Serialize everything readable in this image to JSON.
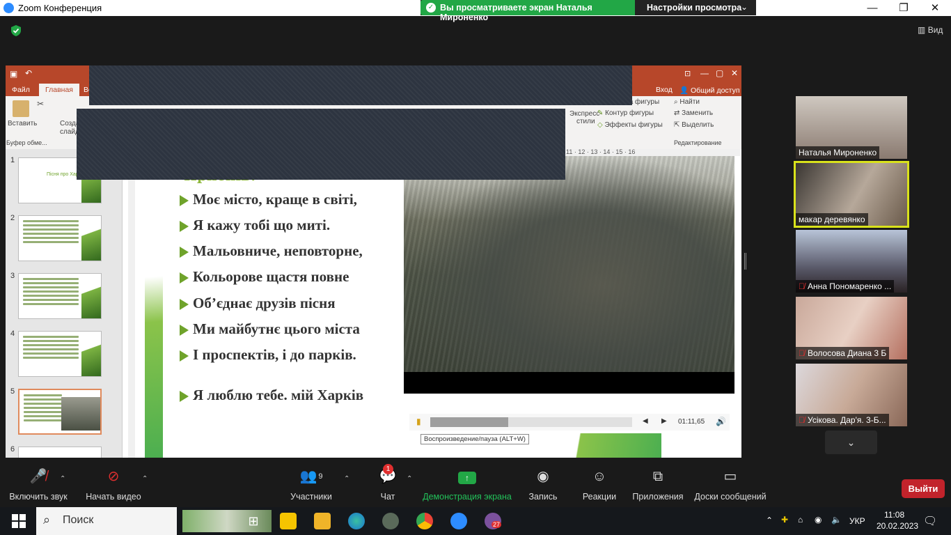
{
  "window": {
    "title": "Zoom Конференция",
    "banner_text": "Вы просматриваете экран Наталья Мироненко",
    "view_settings": "Настройки просмотра",
    "view_button": "Вид"
  },
  "ppt": {
    "tabs": [
      "Файл",
      "Главная",
      "Во"
    ],
    "signin": "Вход",
    "share": "Общий доступ",
    "ribbon_left": [
      "Вставить",
      "Созда",
      "слайд",
      "Буфер обме..."
    ],
    "ribbon_right": [
      "Заливка фигуры",
      "Контур фигуры",
      "Эффекты фигуры",
      "Экспресс-",
      "стили",
      "Найти",
      "Заменить",
      "Выделить",
      "Редактирование"
    ],
    "ruler_ticks": "11 · 12 · 13 · 14 · 15 · 16",
    "thumb_title": "Пісня про Харків"
  },
  "slide": {
    "chorus": "Приспів:",
    "lines": [
      "Моє місто, краще в світі,",
      "Я кажу тобі що миті.",
      "Мальовниче, неповторне,",
      "Кольорове щастя повне",
      "Об’єднає друзів пісня",
      "Ми майбутнє цього міста",
      "І проспектів, і до парків.",
      "Я люблю тебе. мій Харків"
    ]
  },
  "video": {
    "time": "01:11,65",
    "tooltip": "Воспроизведение/пауза (ALT+W)",
    "progress": 0.386
  },
  "participants": [
    {
      "name": "Наталья Мироненко",
      "muted": false,
      "active": false
    },
    {
      "name": "макар  деревянко",
      "muted": false,
      "active": true
    },
    {
      "name": "Анна Пономаренко ...",
      "muted": true,
      "active": false
    },
    {
      "name": "Волосова Диана 3 Б",
      "muted": true,
      "active": false
    },
    {
      "name": "Усікова.  Дар'я. 3-Б...",
      "muted": true,
      "active": false
    }
  ],
  "toolbar": {
    "audio": "Включить звук",
    "video": "Начать видео",
    "participants": "Участники",
    "participants_count": "9",
    "chat": "Чат",
    "chat_badge": "1",
    "share": "Демонстрация экрана",
    "record": "Запись",
    "reactions": "Реакции",
    "apps": "Приложения",
    "whiteboards": "Доски сообщений",
    "leave": "Выйти"
  },
  "taskbar": {
    "search": "Поиск",
    "lang": "УКР",
    "time": "11:08",
    "date": "20.02.2023",
    "viber_badge": "27"
  },
  "colors": {
    "ppt_accent": "#b7472a",
    "zoom_green": "#22a746",
    "leave_red": "#c2232b",
    "active_speaker": "#d9e21b"
  }
}
